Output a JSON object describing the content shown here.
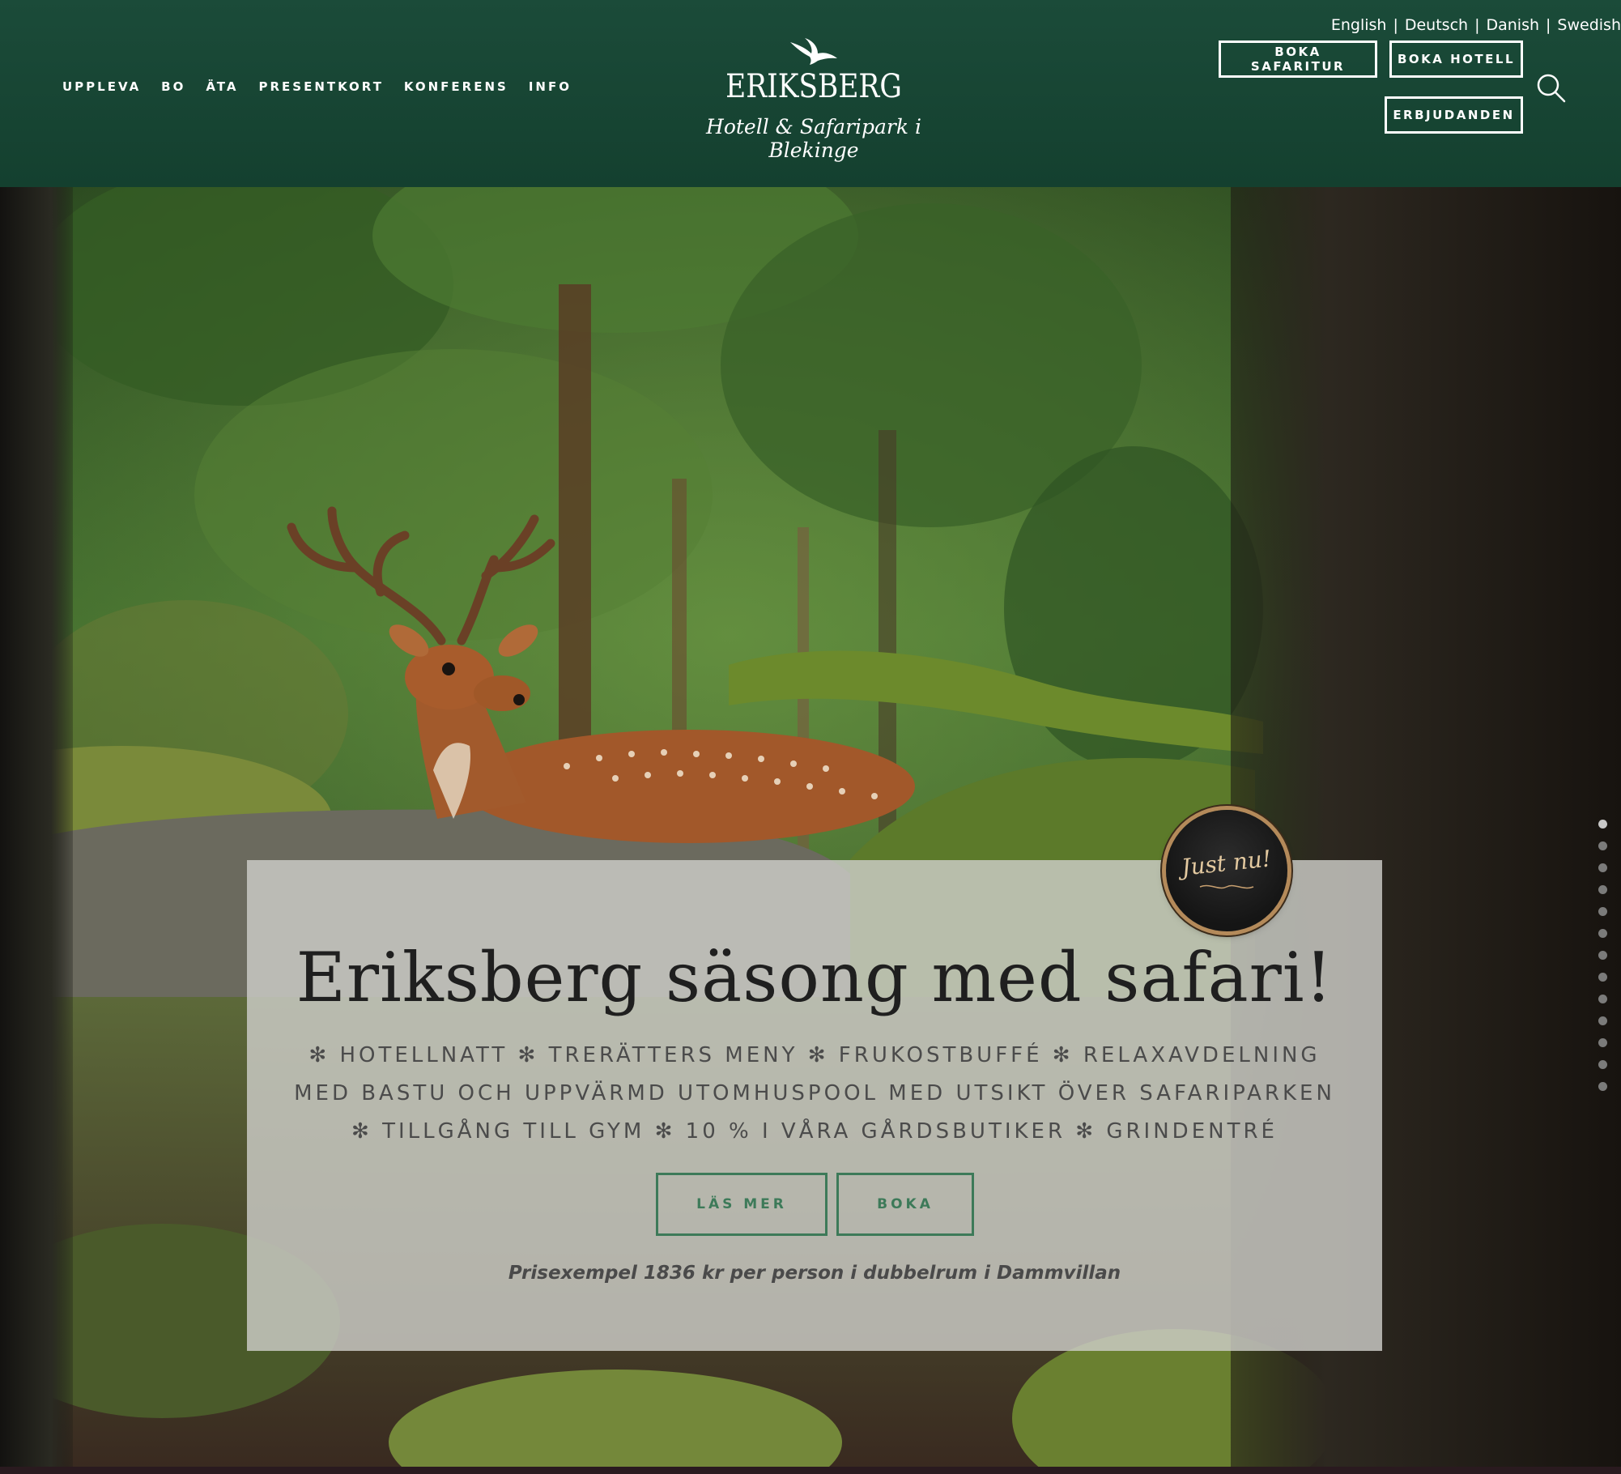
{
  "header": {
    "languages": [
      "English",
      "Deutsch",
      "Danish",
      "Swedish"
    ],
    "language_separator": "|",
    "nav": [
      "UPPLEVA",
      "BO",
      "ÄTA",
      "PRESENTKORT",
      "KONFERENS",
      "INFO"
    ],
    "logo_name": "ERIKSBERG",
    "logo_tagline": "Hotell & Safaripark i Blekinge",
    "buttons": {
      "safari": "BOKA SAFARITUR",
      "hotel": "BOKA HOTELL",
      "offers": "ERBJUDANDEN"
    },
    "search_icon": "search-icon"
  },
  "hero": {
    "badge_text": "Just nu!",
    "title": "Eriksberg säsong med safari!",
    "features": "✻ HOTELLNATT ✻ TRERÄTTERS MENY ✻ FRUKOSTBUFFÉ ✻ RELAXAVDELNING MED BASTU OCH UPPVÄRMD UTOMHUSPOOL MED UTSIKT ÖVER SAFARIPARKEN ✻ TILLGÅNG TILL GYM ✻ 10 % I VÅRA GÅRDSBUTIKER ✻ GRINDENTRÉ",
    "read_more": "LÄS MER",
    "book": "BOKA",
    "price_example": "Prisexempel 1836 kr per person i dubbelrum i Dammvillan",
    "slide_count": 13,
    "active_slide": 1
  },
  "colors": {
    "header_green": "#1b4b39",
    "button_green": "#3d7a59",
    "panel": "rgba(205,205,200,0.82)"
  }
}
